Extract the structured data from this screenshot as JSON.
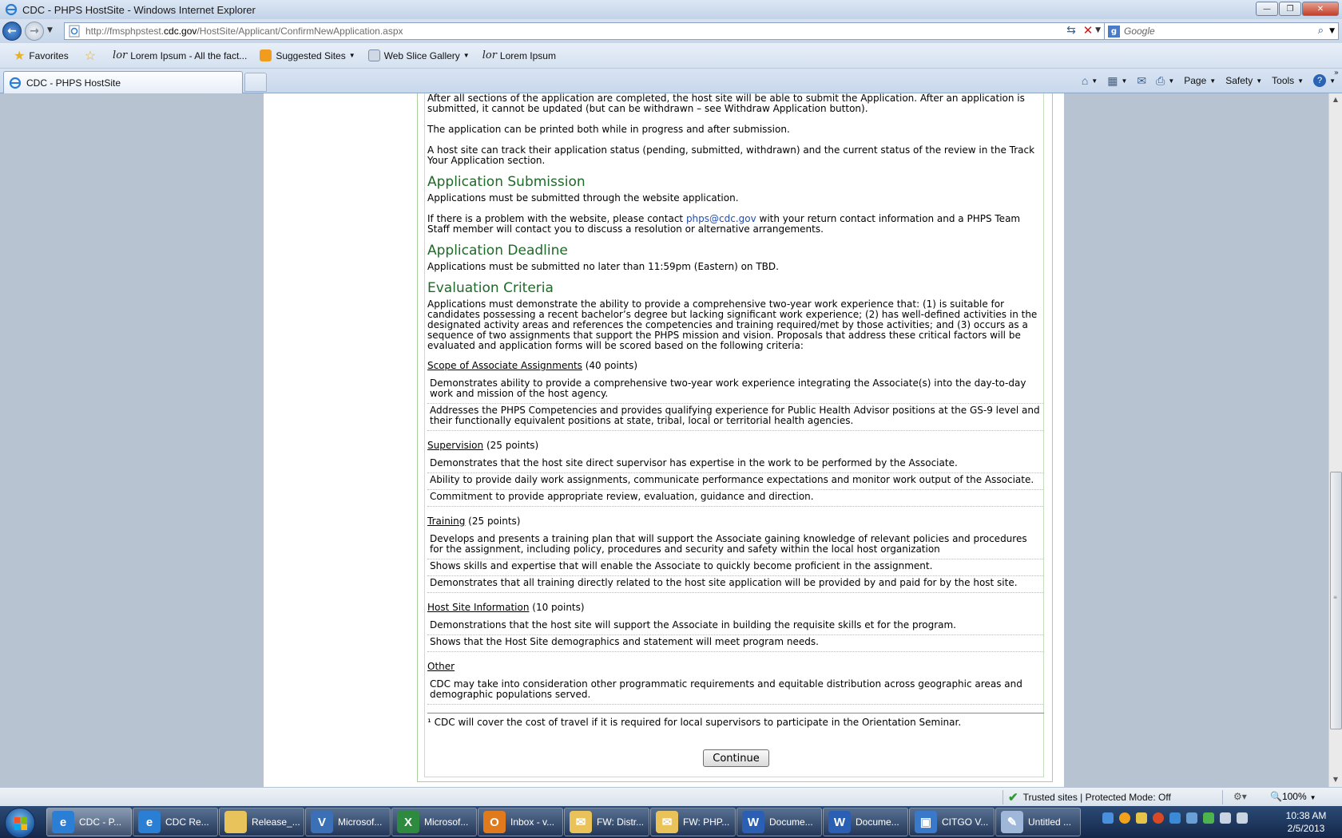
{
  "window": {
    "title": "CDC - PHPS HostSite - Windows Internet Explorer",
    "min_glyph": "—",
    "max_glyph": "❐",
    "close_glyph": "✕"
  },
  "address": {
    "url_prefix": "http://fmsphpstest.",
    "url_domain": "cdc.gov",
    "url_path": "/HostSite/Applicant/ConfirmNewApplication.aspx",
    "search_placeholder": "Google"
  },
  "favorites": {
    "label": "Favorites",
    "items": [
      {
        "label": "Lorem Ipsum - All the fact..."
      },
      {
        "label": "Suggested Sites"
      },
      {
        "label": "Web Slice Gallery"
      },
      {
        "label": "Lorem Ipsum"
      }
    ]
  },
  "tab": {
    "label": "CDC - PHPS HostSite"
  },
  "commands": {
    "page": "Page",
    "safety": "Safety",
    "tools": "Tools"
  },
  "content": {
    "intro": [
      "After all sections of the application are completed, the host site will be able to submit the Application. After an application is submitted, it cannot be updated (but can be withdrawn – see Withdraw Application button).",
      "The application can be printed both while in progress and after submission.",
      "A host site can track their application status (pending, submitted, withdrawn) and the current status of the review in the Track Your Application section."
    ],
    "submission": {
      "heading": "Application Submission",
      "line1": "Applications must be submitted through the website application.",
      "line2_pre": "If there is a problem with the website, please contact ",
      "email": "phps@cdc.gov",
      "line2_post": " with your return contact information and a PHPS Team Staff member will contact you to discuss a resolution or alternative arrangements."
    },
    "deadline": {
      "heading": "Application Deadline",
      "text": "Applications must be submitted no later than 11:59pm (Eastern) on TBD."
    },
    "evaluation": {
      "heading": "Evaluation Criteria",
      "text": "Applications must demonstrate the ability to provide a comprehensive two-year work experience that: (1) is suitable for candidates possessing a recent bachelor’s degree but lacking significant work experience; (2) has well-defined activities in the designated activity areas and references the competencies and training required/met by those activities; and (3) occurs as a sequence of two assignments that support the PHPS mission and vision. Proposals that address these critical factors will be evaluated and application forms will be scored based on the following criteria:"
    },
    "criteria": [
      {
        "title": "Scope of Associate Assignments",
        "points": " (40 points)",
        "items": [
          "Demonstrates ability to provide a comprehensive two-year work experience integrating the Associate(s) into the day-to-day work and mission of the host agency.",
          "Addresses the PHPS Competencies and provides qualifying experience for Public Health Advisor positions at the GS-9 level and their functionally equivalent positions at state, tribal, local or territorial health agencies."
        ]
      },
      {
        "title": "Supervision",
        "points": " (25 points)",
        "items": [
          "Demonstrates that the host site direct supervisor has expertise in the work to be performed by the Associate.",
          "Ability to provide daily work assignments, communicate performance expectations and monitor work output of the Associate.",
          "Commitment to provide appropriate review, evaluation, guidance and direction."
        ]
      },
      {
        "title": "Training",
        "points": " (25 points)",
        "items": [
          "Develops and presents a training plan that will support the Associate gaining knowledge of relevant policies and procedures for the assignment, including policy, procedures and security and safety within the local host organization",
          "Shows skills and expertise that will enable the Associate to quickly become proficient in the assignment.",
          "Demonstrates that all training directly related to the host site application will be provided by and paid for by the host site."
        ]
      },
      {
        "title": "Host Site Information",
        "points": " (10 points)",
        "items": [
          "Demonstrations that the host site will support the Associate in building the requisite skills et for the program.",
          "Shows that the Host Site demographics and statement will meet program needs."
        ]
      },
      {
        "title": "Other",
        "points": "",
        "items": [
          "CDC may take into consideration other programmatic requirements and equitable distribution across geographic areas and demographic populations served."
        ]
      }
    ],
    "footnote": "¹ CDC will cover the cost of travel if it is required for local supervisors to participate in the Orientation Seminar.",
    "continue_label": "Continue"
  },
  "status": {
    "zone": "Trusted sites | Protected Mode: Off",
    "zoom": "100%"
  },
  "taskbar": {
    "items": [
      {
        "label": "CDC - P...",
        "icon": "ie-icon",
        "color": "#2a7fd4",
        "glyph": "e"
      },
      {
        "label": "CDC Re...",
        "icon": "ie-icon",
        "color": "#2a7fd4",
        "glyph": "e"
      },
      {
        "label": "Release_...",
        "icon": "folder-icon",
        "color": "#e8c25a",
        "glyph": ""
      },
      {
        "label": "Microsof...",
        "icon": "visio-icon",
        "color": "#3b6fb6",
        "glyph": "V"
      },
      {
        "label": "Microsof...",
        "icon": "excel-icon",
        "color": "#2d8a3e",
        "glyph": "X"
      },
      {
        "label": "Inbox - v...",
        "icon": "outlook-icon",
        "color": "#e07a1c",
        "glyph": "O"
      },
      {
        "label": "FW: Distr...",
        "icon": "mail-icon",
        "color": "#e9c35a",
        "glyph": "✉"
      },
      {
        "label": "FW: PHP...",
        "icon": "mail-icon",
        "color": "#e9c35a",
        "glyph": "✉"
      },
      {
        "label": "Docume...",
        "icon": "word-icon",
        "color": "#2b5fb4",
        "glyph": "W"
      },
      {
        "label": "Docume...",
        "icon": "word-icon",
        "color": "#2b5fb4",
        "glyph": "W"
      },
      {
        "label": "CITGO V...",
        "icon": "remote-desktop-icon",
        "color": "#3a78c9",
        "glyph": "▣"
      },
      {
        "label": "Untitled ...",
        "icon": "paint-icon",
        "color": "#9fb7d8",
        "glyph": "✎"
      }
    ],
    "clock_time": "10:38 AM",
    "clock_date": "2/5/2013"
  }
}
